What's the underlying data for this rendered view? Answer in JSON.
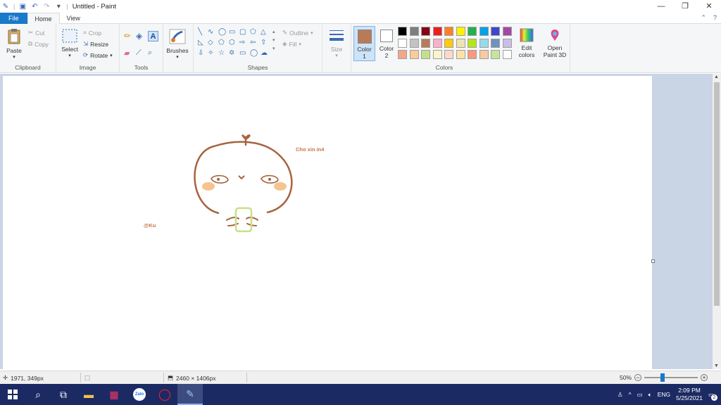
{
  "titlebar": {
    "title": "Untitled - Paint",
    "qat_separator": "|"
  },
  "tabs": {
    "file": "File",
    "home": "Home",
    "view": "View"
  },
  "ribbon": {
    "clipboard": {
      "label": "Clipboard",
      "paste": "Paste",
      "cut": "Cut",
      "copy": "Copy"
    },
    "image": {
      "label": "Image",
      "select": "Select",
      "crop": "Crop",
      "resize": "Resize",
      "rotate": "Rotate"
    },
    "tools": {
      "label": "Tools"
    },
    "brushes": {
      "label": "Brushes"
    },
    "shapes": {
      "label": "Shapes",
      "outline": "Outline",
      "fill": "Fill"
    },
    "size": {
      "label": "Size"
    },
    "colors": {
      "label": "Colors",
      "color1": "Color",
      "color1_num": "1",
      "color2": "Color",
      "color2_num": "2",
      "color1_value": "#b97a57",
      "color2_value": "#ffffff",
      "edit": "Edit",
      "edit2": "colors",
      "paint3d": "Open",
      "paint3d2": "Paint 3D",
      "row1": [
        "#000000",
        "#7f7f7f",
        "#880015",
        "#ed1c24",
        "#ff7f27",
        "#fff200",
        "#22b14c",
        "#00a2e8",
        "#3f48cc",
        "#a349a4"
      ],
      "row2": [
        "#ffffff",
        "#c3c3c3",
        "#b97a57",
        "#ffaec9",
        "#ffc90e",
        "#efe4b0",
        "#b5e61d",
        "#99d9ea",
        "#7092be",
        "#c8bfe7"
      ],
      "row3": [
        "#f4a68a",
        "#f9cc9a",
        "#c5e08a",
        "#fff3c9",
        "#fbd9cb",
        "#fde3a8",
        "#f79a7e",
        "#f9c9a0",
        "#c6e59a",
        "#ffffff"
      ]
    }
  },
  "canvas": {
    "text_top": "Cho xin in4",
    "text_left": "@Ku"
  },
  "statusbar": {
    "cursor_pos": "1971, 349px",
    "image_size": "2460 × 1406px",
    "zoom": "50%",
    "zoom_fraction": 0.5
  },
  "taskbar": {
    "lang": "ENG",
    "time": "2:09 PM",
    "date": "5/25/2021",
    "notif": "2"
  },
  "colors": {
    "accent": "#1979ca",
    "drawing": "#a6633f",
    "text_brown": "#c7754a",
    "blush": "#f5c48f",
    "phone": "#c8e08a",
    "taskbar": "#1c2a63"
  }
}
